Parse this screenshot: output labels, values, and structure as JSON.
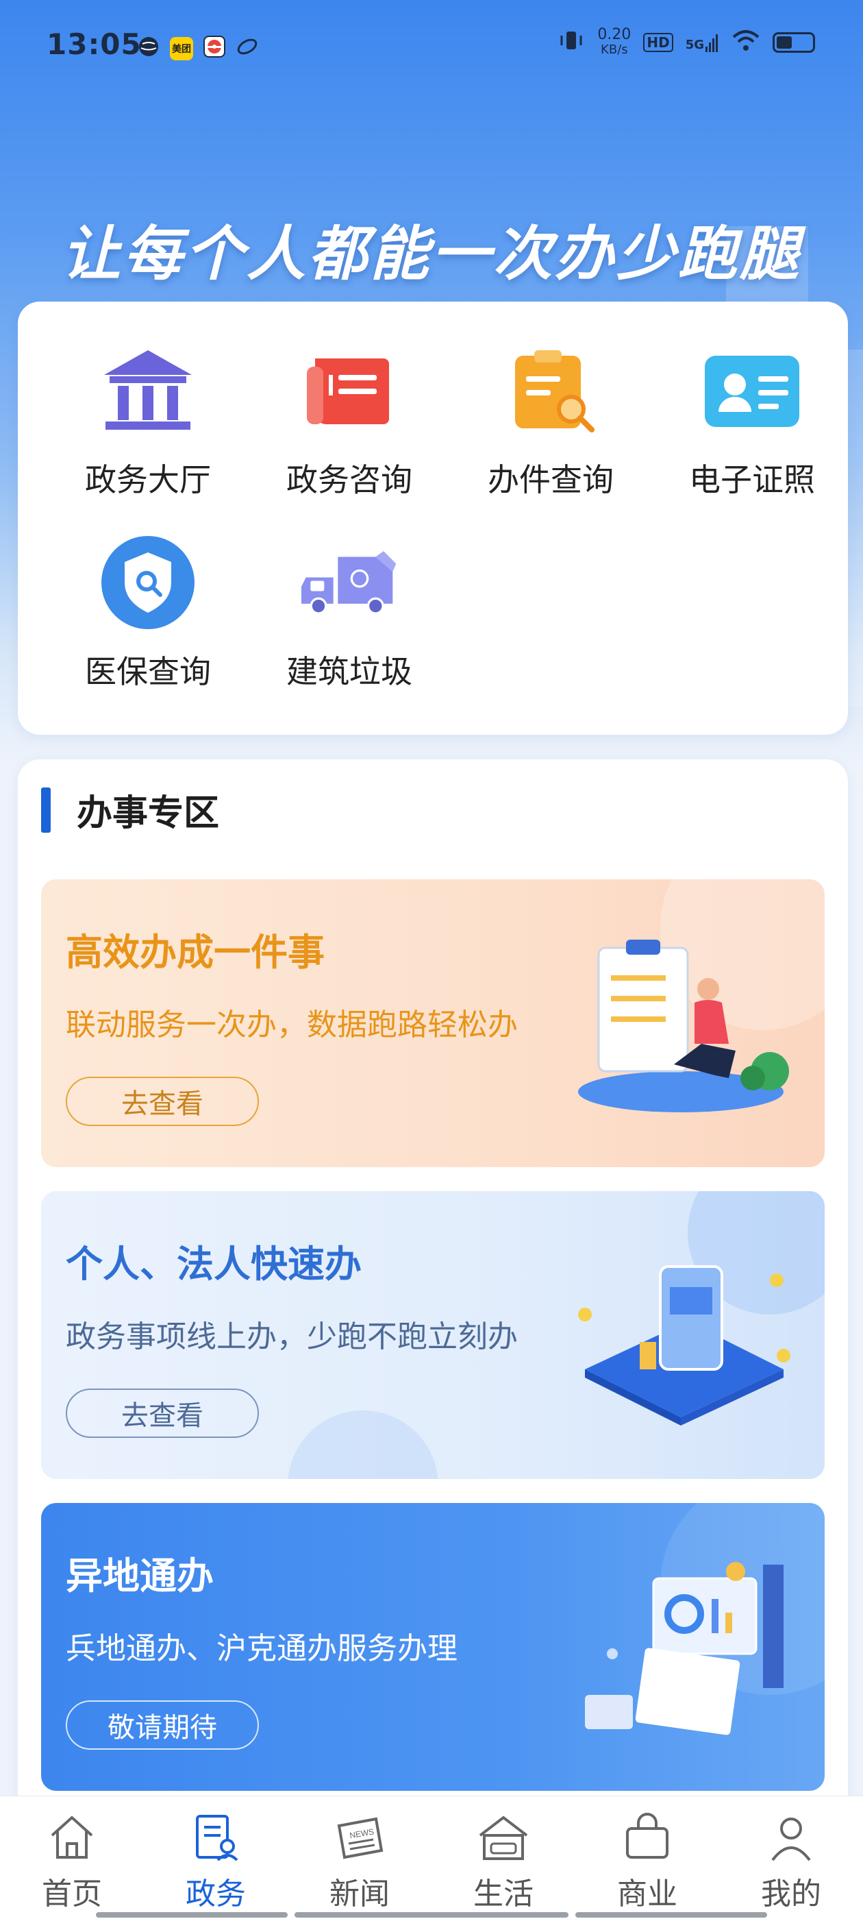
{
  "status_bar": {
    "time": "13:05",
    "net_speed_value": "0.20",
    "net_speed_unit": "KB/s",
    "hd": "HD",
    "network": "5G",
    "left_icons": [
      "globe-icon",
      "meituan-icon",
      "pokeball-icon",
      "leaf-icon"
    ],
    "meituan_label": "美团"
  },
  "hero": {
    "slogan": "让每个人都能一次办少跑腿"
  },
  "services": [
    {
      "label": "政务大厅",
      "icon": "government-building-icon",
      "color": "#6b63d9"
    },
    {
      "label": "政务咨询",
      "icon": "consult-document-icon",
      "color": "#ef4a3f"
    },
    {
      "label": "办件查询",
      "icon": "clipboard-search-icon",
      "color": "#f5a829"
    },
    {
      "label": "电子证照",
      "icon": "id-card-icon",
      "color": "#3cb9ee"
    },
    {
      "label": "医保查询",
      "icon": "shield-search-icon",
      "color": "#3b8be8"
    },
    {
      "label": "建筑垃圾",
      "icon": "garbage-truck-icon",
      "color": "#8a8ff0"
    }
  ],
  "zone": {
    "title": "办事专区",
    "banners": [
      {
        "title": "高效办成一件事",
        "desc": "联动服务一次办，数据跑路轻松办",
        "button": "去查看"
      },
      {
        "title": "个人、法人快速办",
        "desc": "政务事项线上办，少跑不跑立刻办",
        "button": "去查看"
      },
      {
        "title": "异地通办",
        "desc": "兵地通办、沪克通办服务办理",
        "button": "敬请期待"
      }
    ]
  },
  "tabbar": {
    "tabs": [
      {
        "label": "首页",
        "icon": "home-icon"
      },
      {
        "label": "政务",
        "icon": "gov-affairs-icon",
        "active": true
      },
      {
        "label": "新闻",
        "icon": "news-icon"
      },
      {
        "label": "生活",
        "icon": "life-icon"
      },
      {
        "label": "商业",
        "icon": "shopping-bag-icon"
      },
      {
        "label": "我的",
        "icon": "user-icon"
      }
    ]
  },
  "colors": {
    "accent": "#1a63d8",
    "hero_blue": "#3d86ee"
  }
}
